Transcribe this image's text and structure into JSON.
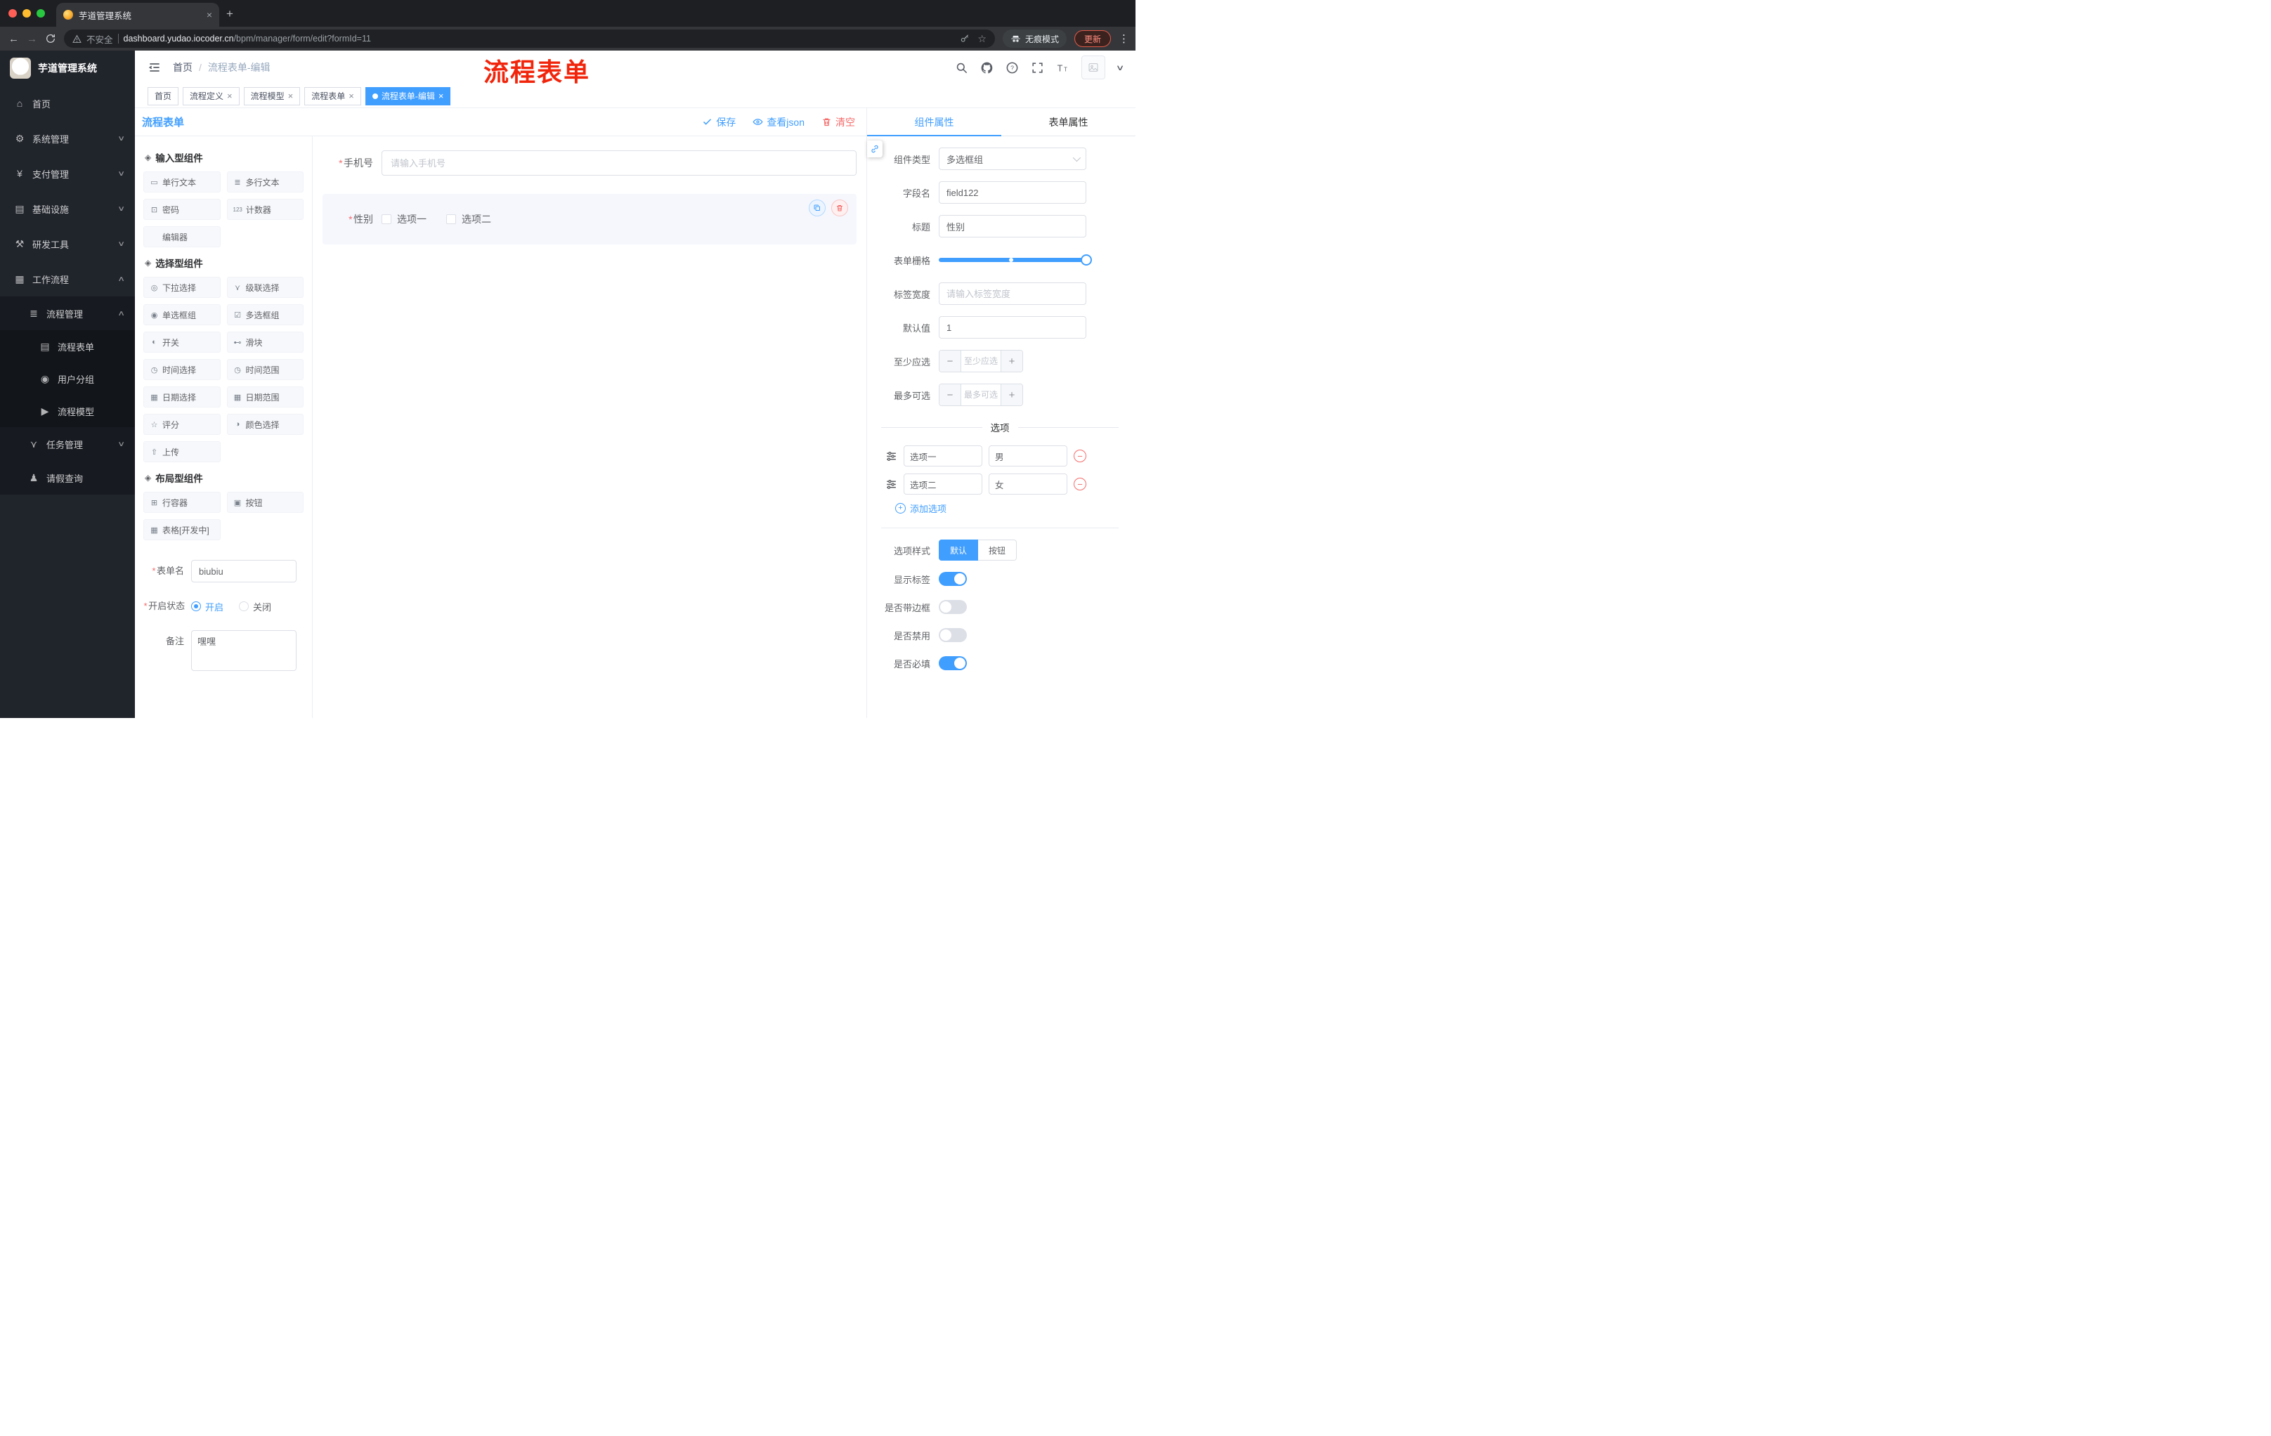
{
  "browser": {
    "tab_title": "芋道管理系统",
    "security_label": "不安全",
    "url_host": "dashboard.yudao.iocoder.cn",
    "url_path": "/bpm/manager/form/edit?formId=11",
    "incognito_label": "无痕模式",
    "update_label": "更新"
  },
  "icons": {
    "close": "×",
    "plus": "+",
    "kebab": "⋮",
    "star": "☆",
    "back": "←",
    "forward": "→",
    "chevron_down": "∨",
    "chevron_up": "∧",
    "minus": "−",
    "caret_down": "∨"
  },
  "sidebar": {
    "logo_title": "芋道管理系统",
    "items": [
      {
        "label": "首页",
        "icon": "home-icon",
        "glyph": "⌂"
      },
      {
        "label": "系统管理",
        "icon": "gear-icon",
        "glyph": "⚙"
      },
      {
        "label": "支付管理",
        "icon": "payment-icon",
        "glyph": "¥"
      },
      {
        "label": "基础设施",
        "icon": "infrastructure-icon",
        "glyph": "▤"
      },
      {
        "label": "研发工具",
        "icon": "devtools-icon",
        "glyph": "⚒"
      },
      {
        "label": "工作流程",
        "icon": "workflow-icon",
        "glyph": "▦"
      }
    ],
    "workflow_submenu": [
      {
        "label": "流程管理",
        "icon": "process-manage-icon",
        "glyph": "≣"
      },
      {
        "label": "任务管理",
        "icon": "task-manage-icon",
        "glyph": "⋎"
      },
      {
        "label": "请假查询",
        "icon": "leave-query-icon",
        "glyph": "♟"
      }
    ],
    "process_children": [
      {
        "label": "流程表单",
        "icon": "process-form-icon",
        "glyph": "▤"
      },
      {
        "label": "用户分组",
        "icon": "user-group-icon",
        "glyph": "◉"
      },
      {
        "label": "流程模型",
        "icon": "process-model-icon",
        "glyph": "▶"
      }
    ]
  },
  "header": {
    "breadcrumb_home": "首页",
    "breadcrumb_separator": "/",
    "breadcrumb_current": "流程表单-编辑",
    "annotation": "流程表单"
  },
  "tags": [
    {
      "label": "首页"
    },
    {
      "label": "流程定义"
    },
    {
      "label": "流程模型"
    },
    {
      "label": "流程表单"
    },
    {
      "label": "流程表单-编辑"
    }
  ],
  "editor": {
    "title": "流程表单",
    "save_label": "保存",
    "view_json_label": "查看json",
    "clear_label": "清空"
  },
  "palette": {
    "groups": [
      {
        "title": "输入型组件",
        "icon_glyph": "◈",
        "items": [
          {
            "label": "单行文本",
            "icon": "text-input-icon",
            "glyph": "▭"
          },
          {
            "label": "多行文本",
            "icon": "textarea-icon",
            "glyph": "≣"
          },
          {
            "label": "密码",
            "icon": "password-icon",
            "glyph": "⊡"
          },
          {
            "label": "计数器",
            "icon": "counter-icon",
            "glyph": "123"
          },
          {
            "label": "编辑器",
            "icon": "editor-icon",
            "glyph": ""
          }
        ]
      },
      {
        "title": "选择型组件",
        "icon_glyph": "◈",
        "items": [
          {
            "label": "下拉选择",
            "icon": "select-icon",
            "glyph": "◎"
          },
          {
            "label": "级联选择",
            "icon": "cascader-icon",
            "glyph": "⋎"
          },
          {
            "label": "单选框组",
            "icon": "radio-group-icon",
            "glyph": "◉"
          },
          {
            "label": "多选框组",
            "icon": "checkbox-group-icon",
            "glyph": "☑"
          },
          {
            "label": "开关",
            "icon": "switch-icon",
            "glyph": "◐"
          },
          {
            "label": "滑块",
            "icon": "slider-icon",
            "glyph": "⊷"
          },
          {
            "label": "时间选择",
            "icon": "time-icon",
            "glyph": "◷"
          },
          {
            "label": "时间范围",
            "icon": "time-range-icon",
            "glyph": "◷"
          },
          {
            "label": "日期选择",
            "icon": "date-icon",
            "glyph": "▦"
          },
          {
            "label": "日期范围",
            "icon": "date-range-icon",
            "glyph": "▦"
          },
          {
            "label": "评分",
            "icon": "rate-icon",
            "glyph": "☆"
          },
          {
            "label": "颜色选择",
            "icon": "color-icon",
            "glyph": "◑"
          },
          {
            "label": "上传",
            "icon": "upload-icon",
            "glyph": "⇧"
          }
        ]
      },
      {
        "title": "布局型组件",
        "icon_glyph": "◈",
        "items": [
          {
            "label": "行容器",
            "icon": "row-container-icon",
            "glyph": "⊞"
          },
          {
            "label": "按钮",
            "icon": "button-icon",
            "glyph": "▣"
          },
          {
            "label": "表格[开发中]",
            "icon": "table-icon",
            "glyph": "▦"
          }
        ]
      }
    ],
    "form": {
      "name_label": "表单名",
      "name_value": "biubiu",
      "status_label": "开启状态",
      "status_on": "开启",
      "status_off": "关闭",
      "remark_label": "备注",
      "remark_value": "嘿嘿"
    }
  },
  "canvas": {
    "phone": {
      "label": "手机号",
      "placeholder": "请输入手机号"
    },
    "gender": {
      "label": "性别",
      "options": [
        "选项一",
        "选项二"
      ]
    }
  },
  "props": {
    "tab_component": "组件属性",
    "tab_form": "表单属性",
    "component_type_label": "组件类型",
    "component_type_value": "多选框组",
    "field_name_label": "字段名",
    "field_name_value": "field122",
    "title_label": "标题",
    "title_value": "性别",
    "grid_label": "表单栅格",
    "label_width_label": "标签宽度",
    "label_width_placeholder": "请输入标签宽度",
    "default_label": "默认值",
    "default_value": "1",
    "min_label": "至少应选",
    "min_placeholder": "至少应选",
    "max_label": "最多可选",
    "max_placeholder": "最多可选",
    "options_title": "选项",
    "options": [
      {
        "name": "选项一",
        "value": "男"
      },
      {
        "name": "选项二",
        "value": "女"
      }
    ],
    "add_option_label": "添加选项",
    "style_label": "选项样式",
    "style_default": "默认",
    "style_button": "按钮",
    "toggle_show_label": "显示标签",
    "toggle_border_label": "是否带边框",
    "toggle_disabled_label": "是否禁用",
    "toggle_required_label": "是否必填"
  },
  "colors": {
    "accent": "#409eff",
    "danger": "#f56c6c",
    "annotation_red": "#f1250c",
    "sidebar_bg": "#20242b"
  }
}
